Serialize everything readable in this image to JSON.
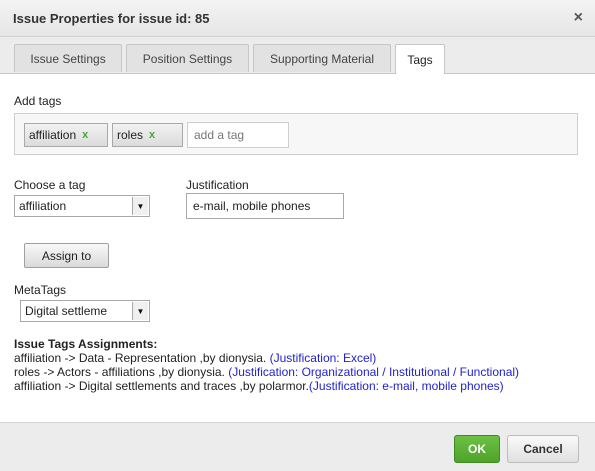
{
  "dialog": {
    "title": "Issue Properties for issue id: 85",
    "close_icon": "×"
  },
  "tabs": [
    {
      "label": "Issue Settings",
      "active": false
    },
    {
      "label": "Position Settings",
      "active": false
    },
    {
      "label": "Supporting Material",
      "active": false
    },
    {
      "label": "Tags",
      "active": true
    }
  ],
  "add_tags": {
    "label": "Add tags",
    "chips": [
      {
        "label": "affiliation",
        "remove": "x"
      },
      {
        "label": "roles",
        "remove": "x"
      }
    ],
    "input_placeholder": "add a tag"
  },
  "choose_tag": {
    "label": "Choose a tag",
    "selected": "affiliation",
    "arrow_icon": "▼"
  },
  "justification": {
    "label": "Justification",
    "value": "e-mail, mobile phones"
  },
  "assign_button": "Assign to",
  "metatags": {
    "label": "MetaTags",
    "selected": "Digital settleme",
    "arrow_icon": "▼"
  },
  "assignments": {
    "heading": "Issue Tags Assignments:",
    "lines": [
      {
        "text": "affiliation -> Data - Representation ,by dionysia. ",
        "justification": "(Justification: Excel)"
      },
      {
        "text": "roles -> Actors - affiliations ,by dionysia. ",
        "justification": "(Justification: Organizational / Institutional / Functional)"
      },
      {
        "text": "affiliation -> Digital settlements and traces ,by polarmor.",
        "justification": "(Justification: e-mail, mobile phones)"
      }
    ]
  },
  "footer": {
    "ok": "OK",
    "cancel": "Cancel"
  },
  "colors": {
    "accent_green": "#5cb335",
    "link_blue": "#2222cc"
  }
}
